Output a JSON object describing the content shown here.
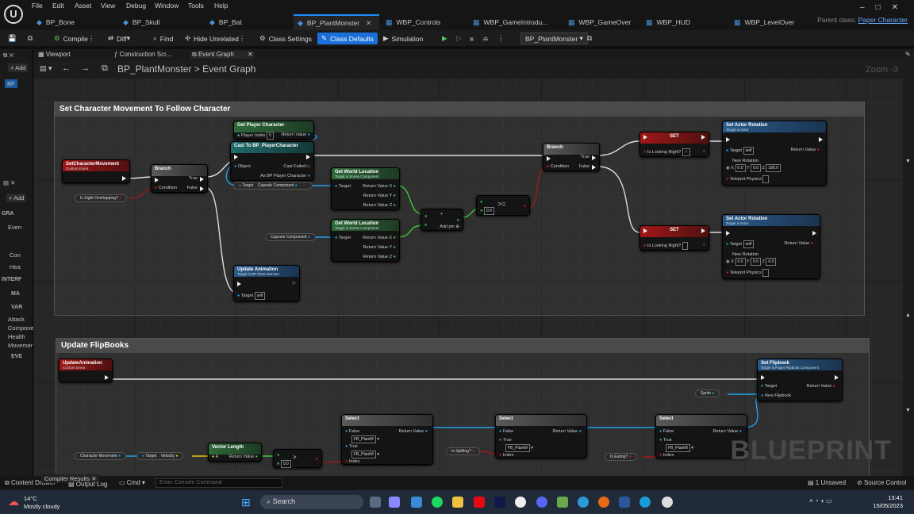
{
  "menu": {
    "items": [
      "File",
      "Edit",
      "Asset",
      "View",
      "Debug",
      "Window",
      "Tools",
      "Help"
    ]
  },
  "tabs": [
    {
      "label": "BP_Bone",
      "active": false
    },
    {
      "label": "BP_Skull",
      "active": false
    },
    {
      "label": "BP_Bat",
      "active": false
    },
    {
      "label": "BP_PlantMonster",
      "active": true
    },
    {
      "label": "WBP_Controls",
      "active": false
    },
    {
      "label": "WBP_GameIntrodu...",
      "active": false
    },
    {
      "label": "WBP_GameOver",
      "active": false
    },
    {
      "label": "WBP_HUD",
      "active": false
    },
    {
      "label": "WBP_LevelOver",
      "active": false
    }
  ],
  "parent_class": {
    "label": "Parent class:",
    "value": "Paper Character"
  },
  "toolbar": {
    "compile": "Compile",
    "diff": "Diff",
    "find": "Find",
    "hide_unrelated": "Hide Unrelated",
    "class_settings": "Class Settings",
    "class_defaults": "Class Defaults",
    "simulation": "Simulation",
    "debug_object": "BP_PlantMonster"
  },
  "left_panel": {
    "add": "Add",
    "bp_item": "BF",
    "add2": "Add",
    "sections": [
      "GRA",
      "Even",
      "Con",
      "Hea",
      "INTERF",
      "MA",
      "VAR"
    ],
    "variables": [
      "Attack",
      "Compone",
      "Health",
      "Movemer"
    ],
    "eve": "EVE"
  },
  "graph_tabs": {
    "viewport": "Viewport",
    "construction": "Construction Scr...",
    "event_graph": "Event Graph"
  },
  "breadcrumb": {
    "blueprint": "BP_PlantMonster",
    "sep": ">",
    "graph": "Event Graph"
  },
  "zoom": "Zoom -3",
  "comments": {
    "c1": "Set Character Movement To Follow Character",
    "c2": "Update FlipBooks"
  },
  "nodes": {
    "set_char_move": {
      "title": "SetCharacterMovement",
      "sub": "Custom Event"
    },
    "sight_var": "Is Sight Overlapping?",
    "branch1": {
      "title": "Branch",
      "true": "True",
      "false": "False",
      "cond": "Condition"
    },
    "get_player": {
      "title": "Get Player Character",
      "idx_label": "Player Index",
      "idx": "0",
      "ret": "Return Value"
    },
    "cast": {
      "title": "Cast To BP_PlayerCharacter",
      "obj": "Object",
      "fail": "Cast Failed",
      "as": "As BP Player Character"
    },
    "target_cap": {
      "target": "Target",
      "cap": "Capsule Component"
    },
    "gwl1": {
      "title": "Get World Location",
      "sub": "Target is Scene Component",
      "target": "Target",
      "rx": "Return Value X",
      "ry": "Return Value Y",
      "rz": "Return Value Z"
    },
    "gwl2": {
      "title": "Get World Location",
      "sub": "Target is Scene Component",
      "target": "Target",
      "rx": "Return Value X",
      "ry": "Return Value Y",
      "rz": "Return Value Z"
    },
    "cap_var": "Capsule Component",
    "add": {
      "title": "+",
      "pin": "Add pin"
    },
    "ge": {
      "op": ">=",
      "val": "0.0"
    },
    "branch2": {
      "title": "Branch",
      "true": "True",
      "false": "False",
      "cond": "Condition"
    },
    "set1": {
      "title": "SET",
      "var": "Is Looking Right?"
    },
    "set2": {
      "title": "SET",
      "var": "Is Looking Right?"
    },
    "sar1": {
      "title": "Set Actor Rotation",
      "sub": "Target is Actor",
      "target": "Target",
      "self": "self",
      "ret": "Return Value",
      "newrot": "New Rotation",
      "x": "0.0",
      "y": "0.0",
      "z": "180.0",
      "tele": "Teleport Physics"
    },
    "sar2": {
      "title": "Set Actor Rotation",
      "sub": "Target is Actor",
      "target": "Target",
      "self": "self",
      "ret": "Return Value",
      "newrot": "New Rotation",
      "x": "0.0",
      "y": "0.0",
      "z": "0.0",
      "tele": "Teleport Physics"
    },
    "upd_anim_call": {
      "title": "Update Animation",
      "sub": "Target is BP Plant Monster",
      "target": "Target",
      "self": "self"
    },
    "upd_anim_evt": {
      "title": "UpdateAnimation",
      "sub": "Custom Event"
    },
    "set_flip": {
      "title": "Set Flipbook",
      "sub": "Target is Paper Flipbook Component",
      "target": "Target",
      "ret": "Return Value",
      "newf": "New Flipbook"
    },
    "sprite_var": "Sprite",
    "sel1": {
      "title": "Select",
      "f": "False",
      "t": "True",
      "ret": "Return Value",
      "idx": "Index",
      "fv": "FB_PlantM",
      "tv": "FB_PlantM"
    },
    "sel2": {
      "title": "Select",
      "f": "False",
      "t": "True",
      "ret": "Return Value",
      "idx": "Index",
      "fv": "FB_PlantM",
      "tv": "FB_PlantM"
    },
    "sel3": {
      "title": "Select",
      "f": "False",
      "t": "True",
      "ret": "Return Value",
      "idx": "Index",
      "fv": "FB_PlantM",
      "tv": "FB_PlantM"
    },
    "is_spitting": "Is Spitting?",
    "is_eating": "Is Eating?",
    "char_move": "Character Movement",
    "target_vel": {
      "target": "Target",
      "vel": "Velocity"
    },
    "vlen": {
      "title": "Vector Length",
      "a": "A",
      "ret": "Return Value"
    },
    "gt": {
      "op": ">",
      "val": "0.0"
    }
  },
  "watermark": "BLUEPRINT",
  "bottom": {
    "content_drawer": "Content Drawer",
    "output_log": "Output Log",
    "cmd": "Cmd",
    "console_placeholder": "Enter Console Command",
    "compiler": "Compiler Results",
    "unsaved": "1 Unsaved",
    "source": "Source Control"
  },
  "taskbar": {
    "temp": "14°C",
    "weather": "Mostly cloudy",
    "search": "Search",
    "time": "13:41",
    "date": "15/05/2023"
  },
  "colors": {
    "accent": "#1a6fd8",
    "exec": "#eeeeee",
    "bool": "#8a0a0a",
    "object": "#1ea0e8",
    "vector": "#f0c020",
    "float": "#3cc83c"
  }
}
